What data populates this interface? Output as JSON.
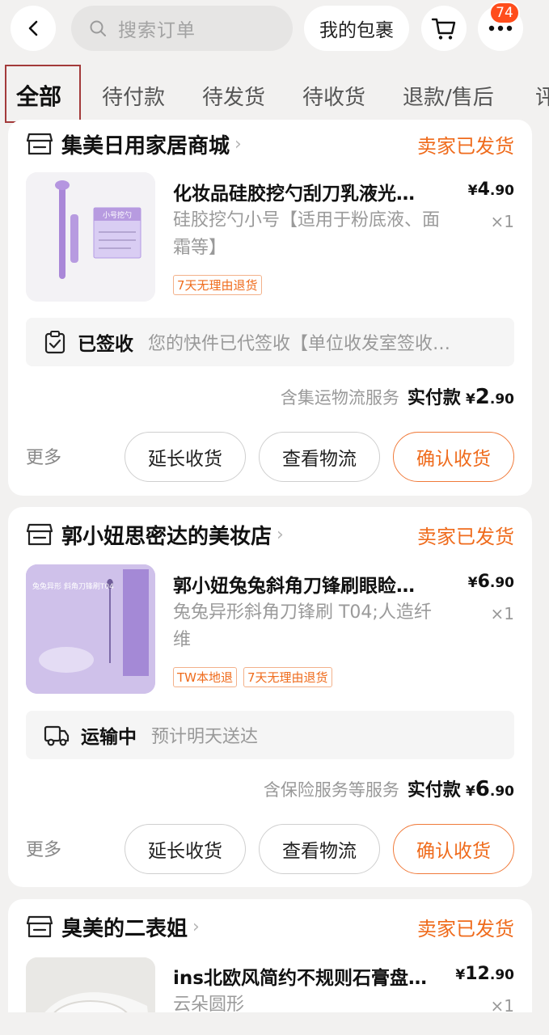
{
  "search": {
    "placeholder": "搜索订单"
  },
  "header": {
    "packages_label": "我的包裹",
    "more_badge": "74"
  },
  "tabs": [
    {
      "label": "全部"
    },
    {
      "label": "待付款"
    },
    {
      "label": "待发货"
    },
    {
      "label": "待收货"
    },
    {
      "label": "退款/售后"
    },
    {
      "label": "评"
    }
  ],
  "orders": [
    {
      "shop": "集美日用家居商城",
      "status": "卖家已发货",
      "title": "化妆品硅胶挖勺刮刀乳液光…",
      "price_int": "4",
      "price_dec": ".90",
      "spec": "硅胶挖勺小号【适用于粉底液、面霜等】",
      "qty": "×1",
      "tags": [
        "7天无理由退货"
      ],
      "thumb_label": "小号挖勺",
      "logistics_status": "已签收",
      "logistics_desc": "您的快件已代签收【单位收发室签收…",
      "pay_note": "含集运物流服务",
      "pay_label": "实付款",
      "pay_int": "2",
      "pay_dec": ".90",
      "more": "更多",
      "btn_extend": "延长收货",
      "btn_logistics": "查看物流",
      "btn_confirm": "确认收货"
    },
    {
      "shop": "郭小妞思密达的美妆店",
      "status": "卖家已发货",
      "title": "郭小妞兔兔斜角刀锋刷眼睑…",
      "price_int": "6",
      "price_dec": ".90",
      "spec": "兔兔异形斜角刀锋刷 T04;人造纤维",
      "qty": "×1",
      "tags": [
        "TW本地退",
        "7天无理由退货"
      ],
      "thumb_label": "兔兔异形 斜角刀锋刷T04",
      "logistics_status": "运输中",
      "logistics_desc": "预计明天送达",
      "pay_note": "含保险服务等服务",
      "pay_label": "实付款",
      "pay_int": "6",
      "pay_dec": ".90",
      "more": "更多",
      "btn_extend": "延长收货",
      "btn_logistics": "查看物流",
      "btn_confirm": "确认收货"
    },
    {
      "shop": "臭美的二表姐",
      "status": "卖家已发货",
      "title": "ins北欧风简约不规则石膏盘…",
      "price_int": "12",
      "price_dec": ".90",
      "spec": "云朵圆形",
      "qty": "×1"
    }
  ],
  "currency": "¥",
  "colors": {
    "accent": "#ef6b1c",
    "badge": "#ff4d1c",
    "background": "#f2f1f0"
  }
}
